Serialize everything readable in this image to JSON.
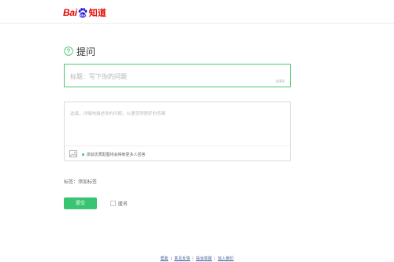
{
  "header": {
    "logo_bai": "Bai",
    "logo_du": "du",
    "logo_zhidao": "知道"
  },
  "main": {
    "title": "提问",
    "title_input": {
      "placeholder": "标题：写下你的问题",
      "counter": "0/49"
    },
    "description": {
      "placeholder": "选填，详细地描述你的问题，以便获得更好的答案",
      "hint": "添加优质配图将会得到更多人回答"
    },
    "tags": {
      "label": "标签：",
      "add": "添加标签"
    },
    "submit_label": "提交",
    "anonymous_label": "匿名"
  },
  "footer": {
    "links": [
      "帮助",
      "意见反馈",
      "投诉举报",
      "加入我们"
    ]
  },
  "colors": {
    "brand_red": "#e10601",
    "paw_blue": "#2319dc",
    "accent_green": "#38c472",
    "link_blue": "#3b5998"
  }
}
